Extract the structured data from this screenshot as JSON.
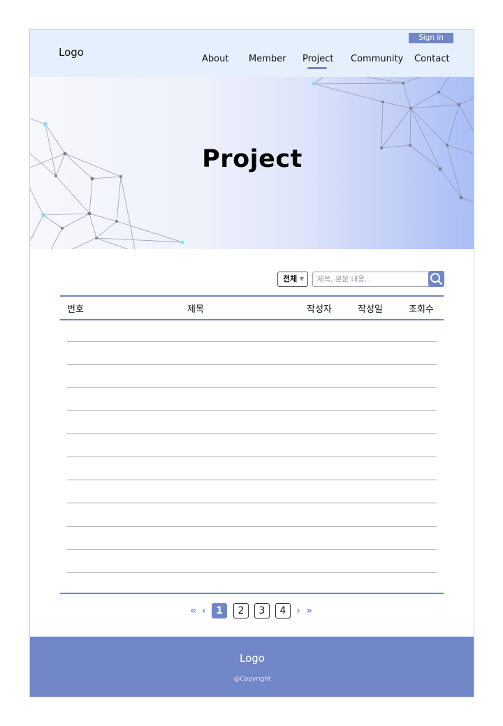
{
  "header": {
    "logo": "Logo",
    "sign_in": "Sign in",
    "nav": [
      "About",
      "Member",
      "Project",
      "Community",
      "Contact"
    ],
    "active_nav": "Project"
  },
  "hero": {
    "title": "Project"
  },
  "search": {
    "filter_value": "전체",
    "placeholder": "제목, 본문 내용.."
  },
  "table": {
    "headers": {
      "number": "번호",
      "title": "제목",
      "author": "작성자",
      "date": "작성일",
      "views": "조회수"
    },
    "rows": []
  },
  "pagination": {
    "first": "«",
    "prev": "‹",
    "pages": [
      "1",
      "2",
      "3",
      "4"
    ],
    "current": "1",
    "next": "›",
    "last": "»"
  },
  "footer": {
    "logo": "Logo",
    "copyright": "@Copyright"
  },
  "colors": {
    "accent": "#7186c6",
    "header_bg": "#e6effc",
    "table_rule": "#6d86b8"
  }
}
